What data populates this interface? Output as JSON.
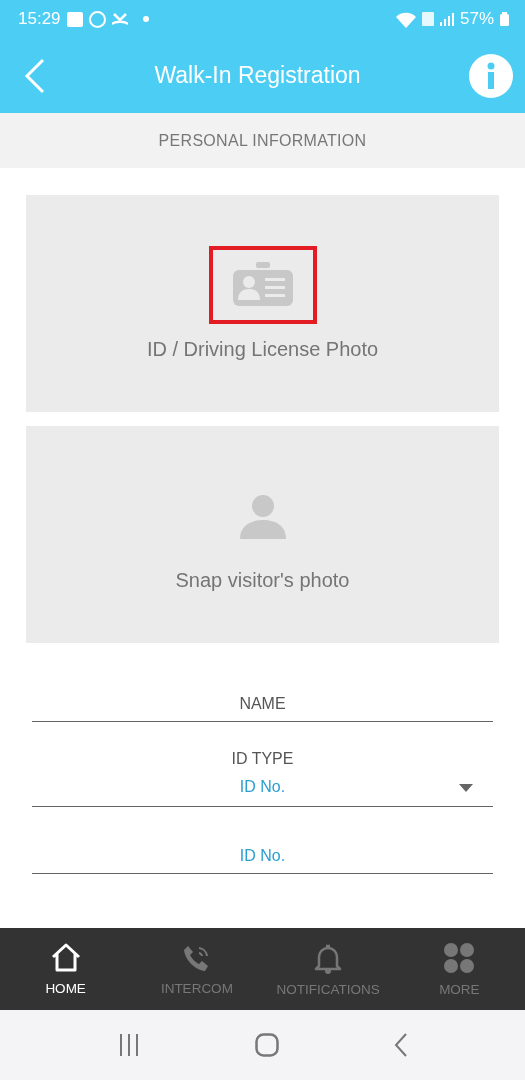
{
  "status_bar": {
    "time": "15:29",
    "battery": "57%"
  },
  "header": {
    "title": "Walk-In Registration"
  },
  "section": {
    "title": "PERSONAL INFORMATION"
  },
  "photo_slots": [
    {
      "kind": "id-card",
      "label": "ID / Driving License Photo",
      "highlighted": true
    },
    {
      "kind": "person",
      "label": "Snap visitor's photo",
      "highlighted": false
    }
  ],
  "fields": [
    {
      "kind": "text",
      "placeholder": "NAME"
    },
    {
      "kind": "select",
      "label": "ID TYPE",
      "value": "ID No."
    },
    {
      "kind": "text-accent",
      "placeholder": "ID No."
    }
  ],
  "bottom_nav": [
    {
      "kind": "home",
      "label": "HOME",
      "selected": true
    },
    {
      "kind": "phone",
      "label": "INTERCOM",
      "selected": false
    },
    {
      "kind": "bell",
      "label": "NOTIFICATIONS",
      "selected": false
    },
    {
      "kind": "grid",
      "label": "MORE",
      "selected": false
    }
  ]
}
